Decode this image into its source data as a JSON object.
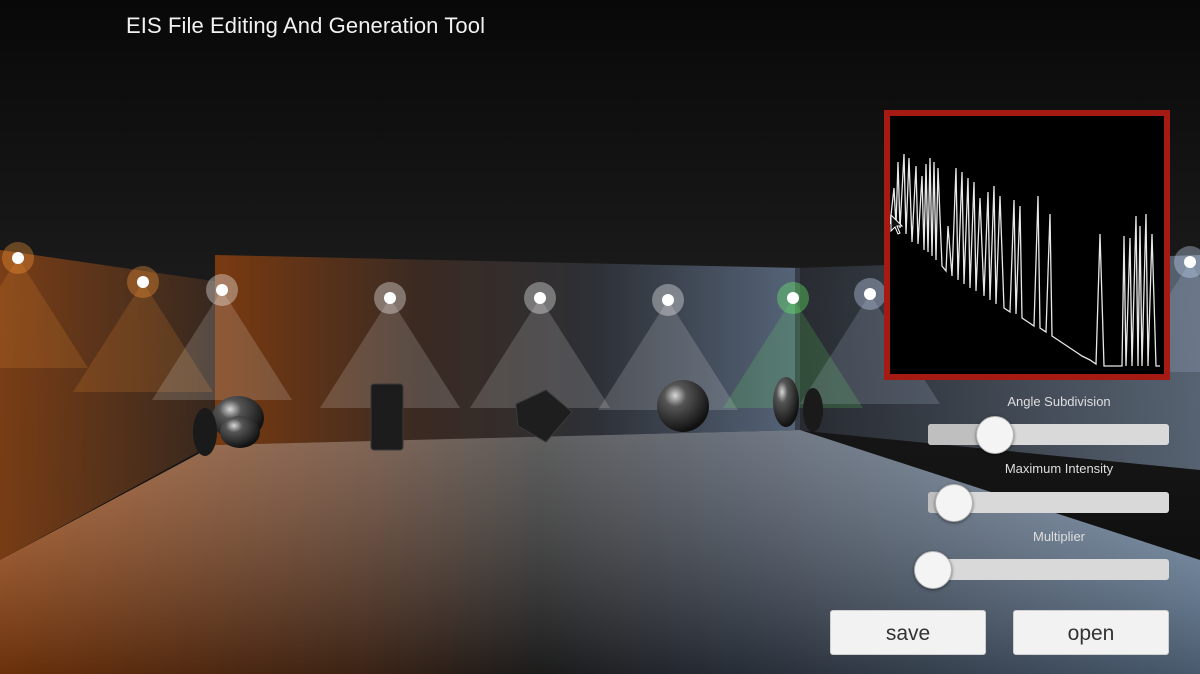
{
  "app": {
    "title": "EIS File Editing And Generation Tool"
  },
  "graph": {
    "border_color": "#a51a12",
    "line_color": "#e8e8e8"
  },
  "sliders": [
    {
      "id": "angle-subdivision",
      "label": "Angle Subdivision",
      "value": 0.27
    },
    {
      "id": "maximum-intensity",
      "label": "Maximum Intensity",
      "value": 0.05
    },
    {
      "id": "multiplier",
      "label": "Multiplier",
      "value": 0.0
    }
  ],
  "buttons": {
    "save_label": "save",
    "open_label": "open"
  },
  "scene": {
    "lights": [
      {
        "color": "#ff9a3a"
      },
      {
        "color": "#ff9a3a"
      },
      {
        "color": "#ffffff"
      },
      {
        "color": "#ffffff"
      },
      {
        "color": "#ffffff"
      },
      {
        "color": "#ffffff"
      },
      {
        "color": "#6cff6c"
      },
      {
        "color": "#cfe2ff"
      },
      {
        "color": "#cfe2ff"
      }
    ]
  }
}
